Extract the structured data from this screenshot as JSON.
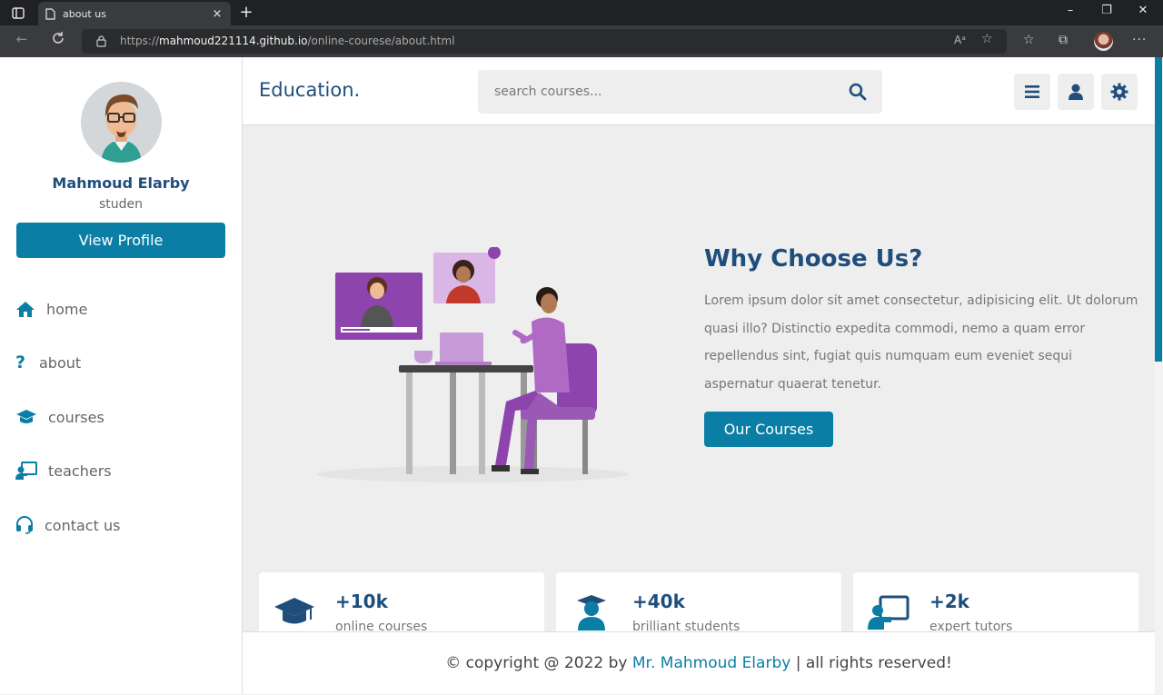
{
  "browser": {
    "tab_title": "about us",
    "tab_close": "×",
    "new_tab": "+",
    "url_prefix": "https://",
    "url_host": "mahmoud221114.github.io",
    "url_path": "/online-courese/about.html",
    "window_controls": {
      "minimize": "–",
      "restore": "❐",
      "close": "✕"
    }
  },
  "sidebar": {
    "name": "Mahmoud Elarby",
    "role": "studen",
    "view_profile": "View Profile",
    "items": [
      {
        "label": "home",
        "icon": "home-icon"
      },
      {
        "label": "about",
        "icon": "question-icon"
      },
      {
        "label": "courses",
        "icon": "graduation-cap-icon"
      },
      {
        "label": "teachers",
        "icon": "chalkboard-teacher-icon"
      },
      {
        "label": "contact us",
        "icon": "headset-icon"
      }
    ]
  },
  "header": {
    "logo": "Education.",
    "search_placeholder": "search courses..."
  },
  "about": {
    "title": "Why Choose Us?",
    "text": "Lorem ipsum dolor sit amet consectetur, adipisicing elit. Ut dolorum quasi illo? Distinctio expedita commodi, nemo a quam error repellendus sint, fugiat quis numquam eum eveniet sequi aspernatur quaerat tenetur.",
    "button": "Our Courses"
  },
  "stats": [
    {
      "number": "+10k",
      "label": "online courses",
      "icon": "graduation-cap-icon"
    },
    {
      "number": "+40k",
      "label": "brilliant students",
      "icon": "user-graduate-icon"
    },
    {
      "number": "+2k",
      "label": "expert tutors",
      "icon": "chalkboard-teacher-icon"
    }
  ],
  "footer": {
    "prefix": "© copyright @ 2022 by ",
    "author": "Mr. Mahmoud Elarby",
    "suffix": " | all rights reserved!"
  },
  "colors": {
    "accent": "#0b7ea6",
    "heading": "#1f4e7d",
    "background": "#eeeeee"
  }
}
